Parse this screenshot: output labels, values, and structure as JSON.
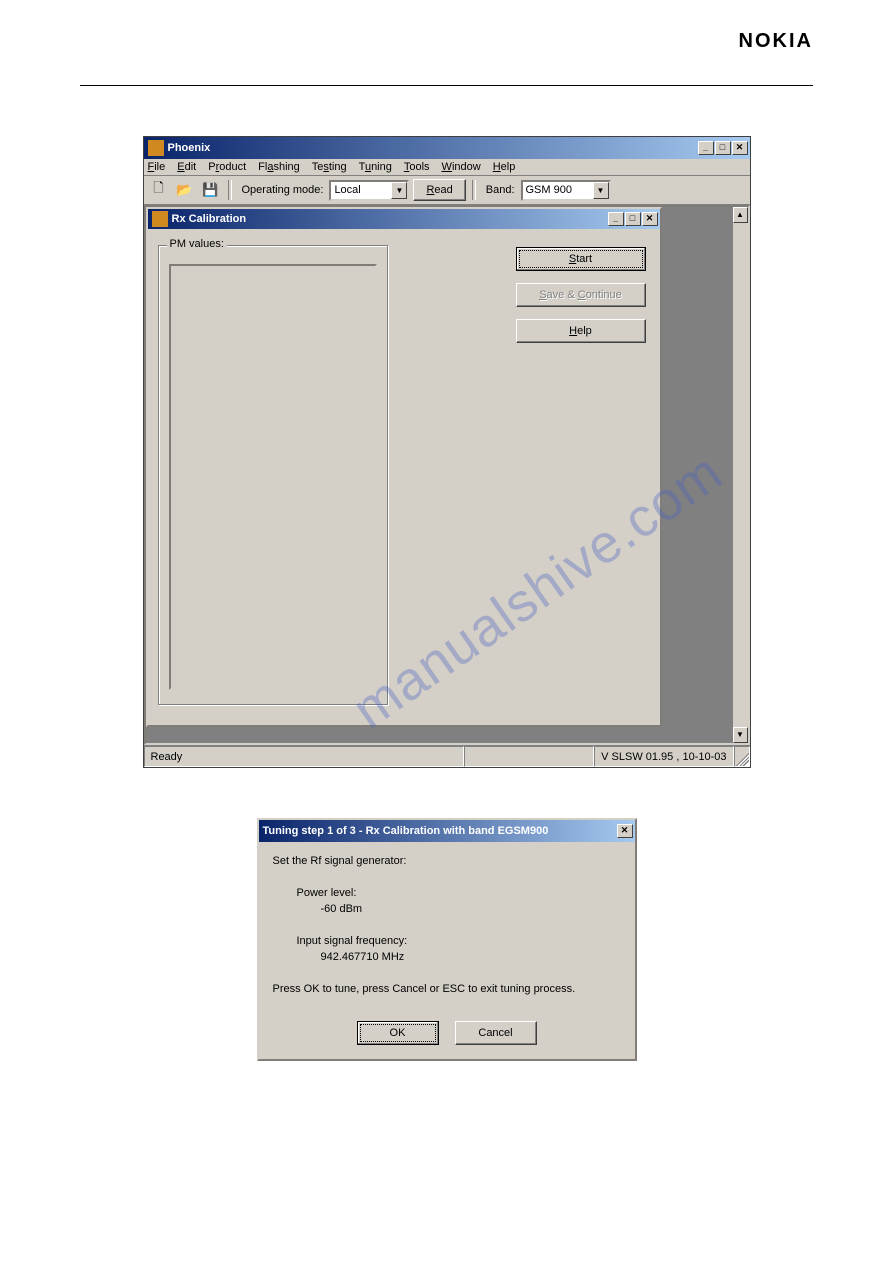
{
  "brand": "NOKIA",
  "watermark": "manualshive.com",
  "app": {
    "title": "Phoenix",
    "menu": [
      "File",
      "Edit",
      "Product",
      "Flashing",
      "Testing",
      "Tuning",
      "Tools",
      "Window",
      "Help"
    ],
    "toolbar": {
      "operating_mode_label": "Operating mode:",
      "operating_mode_value": "Local",
      "read_label": "Read",
      "band_label": "Band:",
      "band_value": "GSM 900"
    },
    "child": {
      "title": "Rx Calibration",
      "group_label": "PM values:",
      "buttons": {
        "start": "Start",
        "save": "Save & Continue",
        "help": "Help"
      }
    },
    "status": {
      "ready": "Ready",
      "version": "V SLSW 01.95 , 10-10-03"
    }
  },
  "dialog": {
    "title": "Tuning step 1 of 3 - Rx Calibration with band EGSM900",
    "line1": "Set the Rf signal generator:",
    "power_label": "Power level:",
    "power_value": "-60 dBm",
    "freq_label": "Input signal frequency:",
    "freq_value": "942.467710 MHz",
    "instruction": "Press OK to tune, press Cancel or ESC to exit tuning process.",
    "ok": "OK",
    "cancel": "Cancel"
  }
}
